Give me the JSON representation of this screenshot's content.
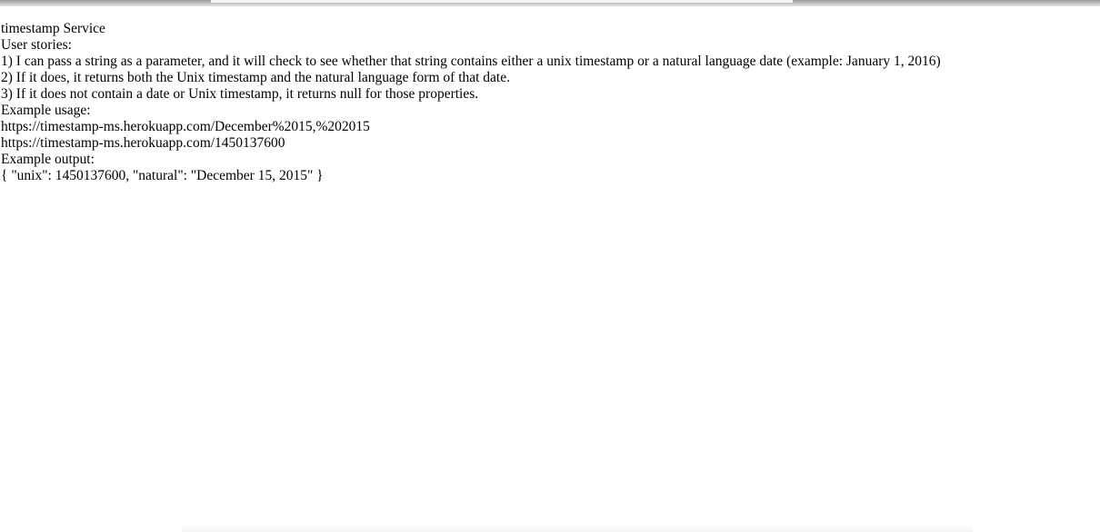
{
  "page": {
    "title": "timestamp Service",
    "stories_heading": "User stories:",
    "stories": [
      "1) I can pass a string as a parameter, and it will check to see whether that string contains either a unix timestamp or a natural language date (example: January 1, 2016)",
      "2) If it does, it returns both the Unix timestamp and the natural language form of that date.",
      "3) If it does not contain a date or Unix timestamp, it returns null for those properties."
    ],
    "usage_heading": "Example usage:",
    "usage_examples": [
      "https://timestamp-ms.herokuapp.com/December%2015,%202015",
      "https://timestamp-ms.herokuapp.com/1450137600"
    ],
    "output_heading": "Example output:",
    "output_example": "{ \"unix\": 1450137600, \"natural\": \"December 15, 2015\" }"
  }
}
